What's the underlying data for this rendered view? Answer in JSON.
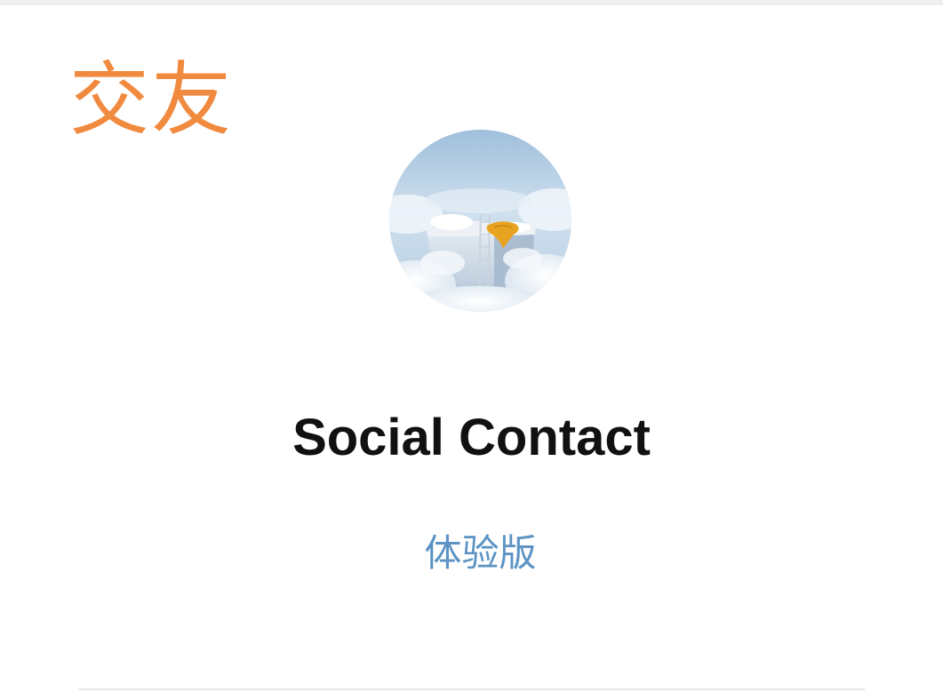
{
  "category": {
    "label": "交友",
    "color": "#f08a3e"
  },
  "app": {
    "avatar_icon": "cloud-gift-box-avatar",
    "name": "Social Contact",
    "version_label": "体验版",
    "version_color": "#5b93c4"
  }
}
